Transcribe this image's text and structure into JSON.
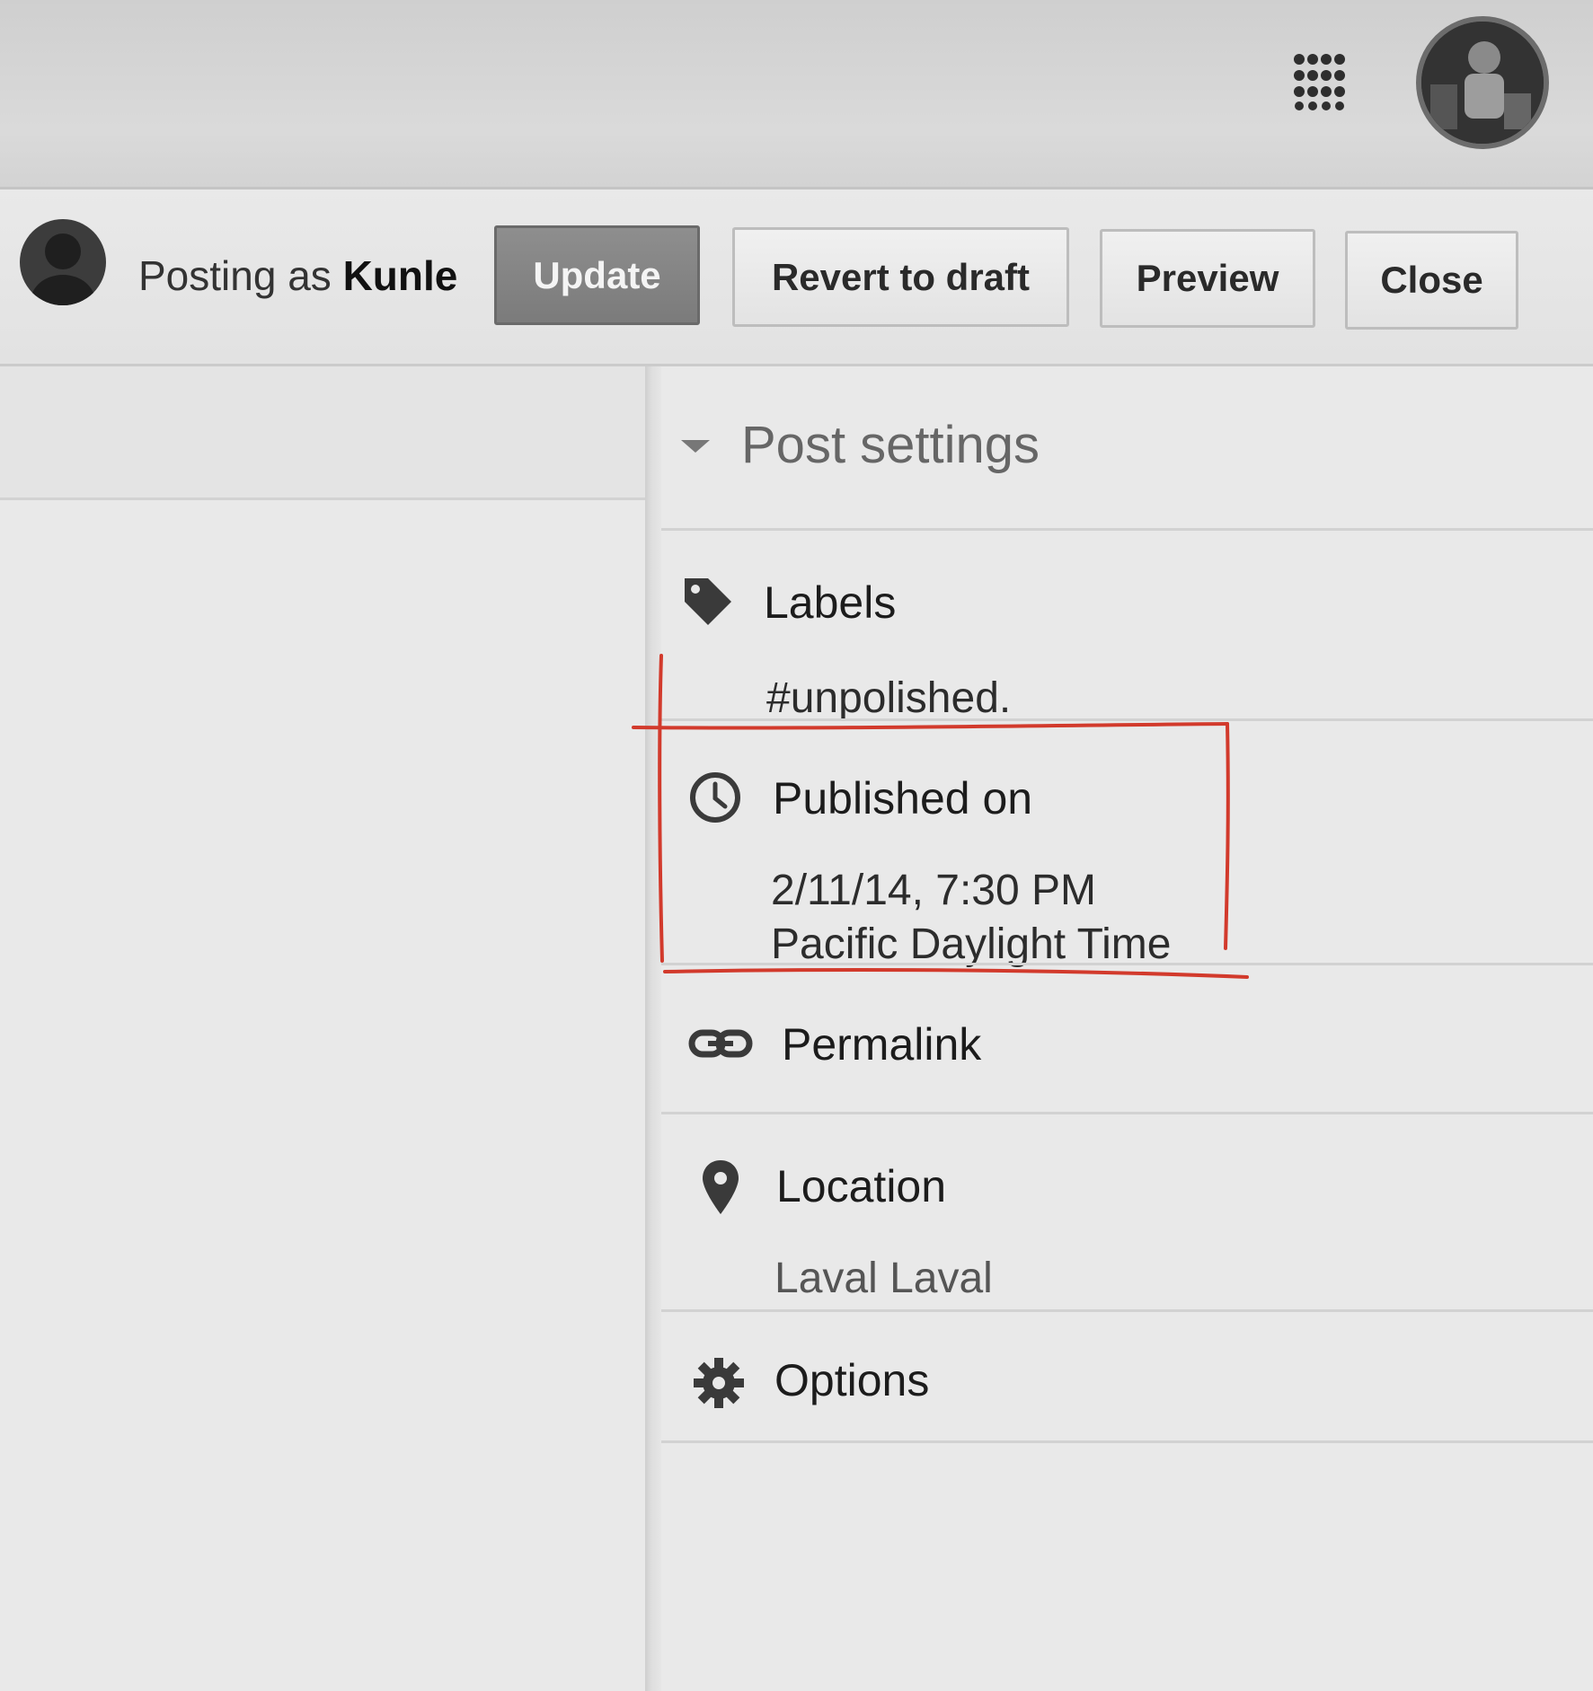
{
  "user": {
    "posting_prefix": "Posting as",
    "name": "Kunle"
  },
  "toolbar": {
    "update_label": "Update",
    "revert_label": "Revert to draft",
    "preview_label": "Preview",
    "close_label": "Close"
  },
  "post_settings": {
    "title": "Post settings",
    "labels": {
      "label": "Labels",
      "value": "#unpolished."
    },
    "published": {
      "label": "Published on",
      "date": "2/11/14, 7:30 PM",
      "timezone": "Pacific Daylight Time"
    },
    "permalink": {
      "label": "Permalink"
    },
    "location": {
      "label": "Location",
      "value": "Laval Laval"
    },
    "options": {
      "label": "Options"
    }
  },
  "icons": [
    "apps-grid-icon",
    "account-avatar",
    "caret-down-icon",
    "label-tag-icon",
    "clock-icon",
    "link-icon",
    "map-pin-icon",
    "gear-icon"
  ],
  "colors": {
    "annotation": "#d23a2c",
    "primary_button": "#858585"
  }
}
